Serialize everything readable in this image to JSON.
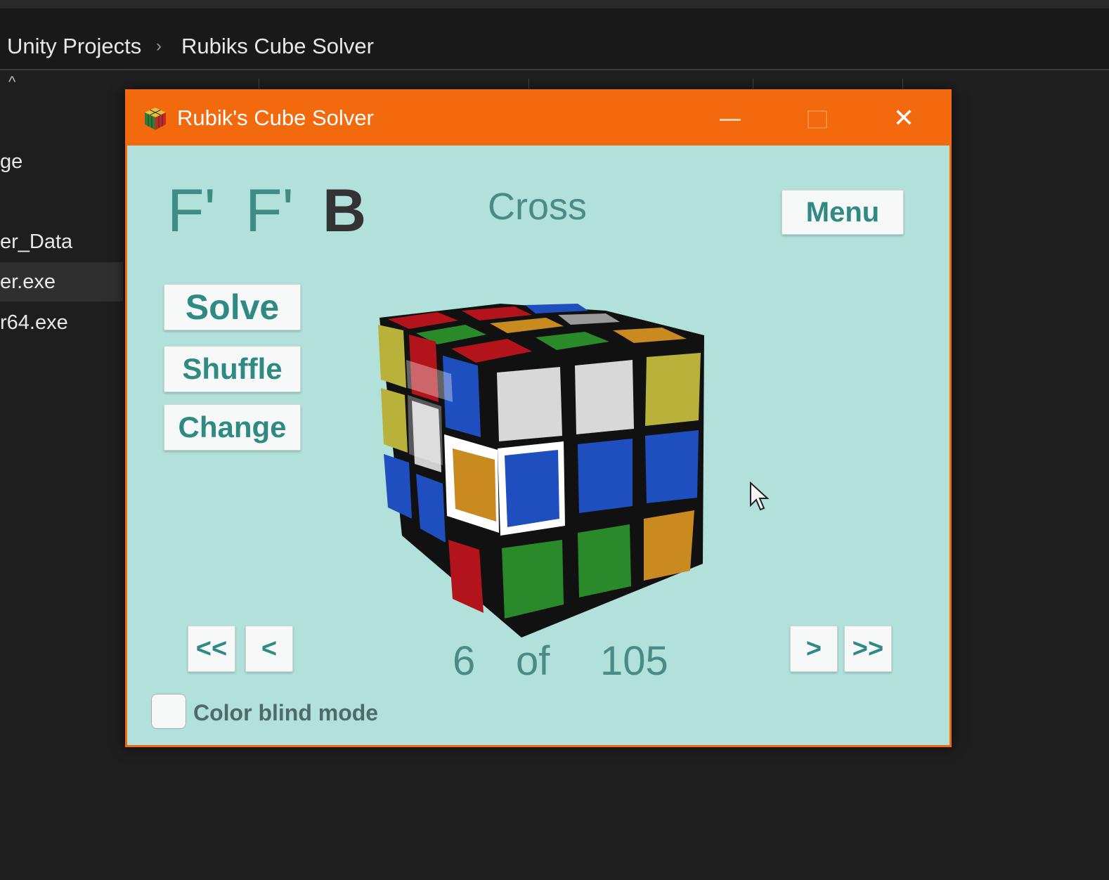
{
  "explorer": {
    "breadcrumb": [
      "Unity Projects",
      "Rubiks Cube Solver"
    ],
    "files": [
      "ge",
      "er_Data",
      "er.exe",
      "r64.exe"
    ]
  },
  "window": {
    "title": "Rubik's Cube Solver",
    "close_glyph": "✕"
  },
  "solver": {
    "moves": [
      "F'",
      "F'",
      "B"
    ],
    "stage": "Cross",
    "menu_label": "Menu",
    "solve_label": "Solve",
    "shuffle_label": "Shuffle",
    "change_label": "Change",
    "nav": {
      "first": "<<",
      "prev": "<",
      "next": ">",
      "last": ">>"
    },
    "step": {
      "current": "6",
      "of": "of",
      "total": "105"
    },
    "color_blind_label": "Color blind mode",
    "color_blind_checked": false
  },
  "colors": {
    "title_bar": "#f36a0e",
    "client_bg": "#b1e1da",
    "button_text": "#2f8a84"
  }
}
